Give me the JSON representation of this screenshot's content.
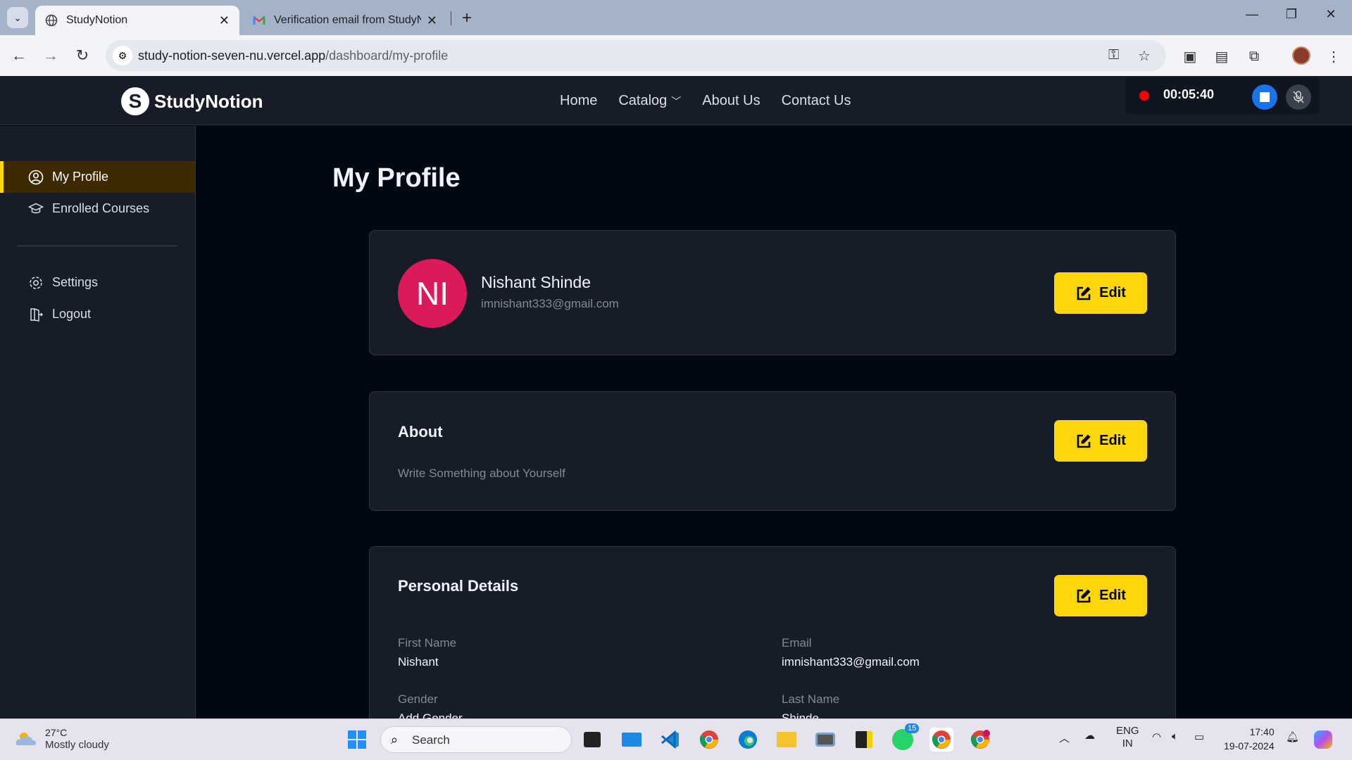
{
  "browser": {
    "tabs": [
      {
        "title": "StudyNotion",
        "active": true
      },
      {
        "title": "Verification email from StudyNc",
        "active": false
      }
    ],
    "url_host": "study-notion-seven-nu.vercel.app",
    "url_path": "/dashboard/my-profile"
  },
  "site": {
    "brand": "StudyNotion",
    "logo_letter": "S",
    "nav": [
      {
        "label": "Home"
      },
      {
        "label": "Catalog"
      },
      {
        "label": "About Us"
      },
      {
        "label": "Contact Us"
      }
    ]
  },
  "recorder": {
    "time": "00:05:40"
  },
  "sidebar": {
    "items": [
      {
        "label": "My Profile",
        "active": true
      },
      {
        "label": "Enrolled Courses"
      },
      {
        "label": "Settings"
      },
      {
        "label": "Logout"
      }
    ]
  },
  "main": {
    "title": "My Profile",
    "profile": {
      "initials": "NI",
      "name": "Nishant Shinde",
      "email": "imnishant333@gmail.com",
      "edit_label": "Edit"
    },
    "about": {
      "heading": "About",
      "text": "Write Something about Yourself",
      "edit_label": "Edit"
    },
    "personal": {
      "heading": "Personal Details",
      "edit_label": "Edit",
      "fields": [
        {
          "label": "First Name",
          "value": "Nishant"
        },
        {
          "label": "Email",
          "value": "imnishant333@gmail.com"
        },
        {
          "label": "Gender",
          "value": "Add Gender"
        },
        {
          "label": "Last Name",
          "value": "Shinde"
        }
      ]
    }
  },
  "taskbar": {
    "temperature": "27°C",
    "weather": "Mostly cloudy",
    "search_placeholder": "Search",
    "whatsapp_badge": "15",
    "lang": "ENG",
    "region": "IN",
    "time": "17:40",
    "date": "19-07-2024"
  },
  "colors": {
    "accent": "#FFD60A",
    "bg": "#000814",
    "card": "#161D29",
    "avatar": "#DB1A5A"
  }
}
